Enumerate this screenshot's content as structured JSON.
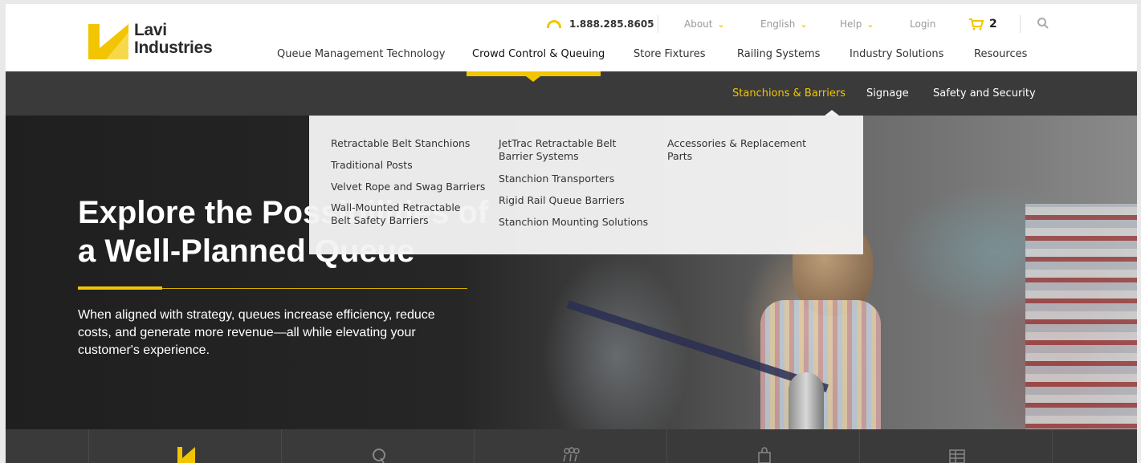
{
  "brand": {
    "name_line1": "Lavi",
    "name_line2": "Industries",
    "accent": "#f2c500"
  },
  "utility": {
    "phone": "1.888.285.8605",
    "about": "About",
    "language": "English",
    "help": "Help",
    "login": "Login",
    "cart_count": "2"
  },
  "main_nav": [
    "Queue Management Technology",
    "Crowd Control & Queuing",
    "Store Fixtures",
    "Railing Systems",
    "Industry Solutions",
    "Resources"
  ],
  "sub_nav": [
    "Stanchions & Barriers",
    "Signage",
    "Safety and Security"
  ],
  "dropdown": {
    "col1": [
      "Retractable Belt Stanchions",
      "Traditional Posts",
      "Velvet Rope and Swag Barriers",
      "Wall-Mounted Retractable Belt Safety Barriers"
    ],
    "col2": [
      "JetTrac Retractable Belt Barrier Systems",
      "Stanchion Transporters",
      "Rigid Rail Queue Barriers",
      "Stanchion Mounting Solutions"
    ],
    "col3": [
      "Accessories & Replacement Parts"
    ]
  },
  "hero": {
    "title": "Explore the Possibilities of a Well-Planned Queue",
    "body": "When aligned with strategy, queues increase efficiency, reduce costs, and generate more revenue—all while elevating your customer's experience."
  },
  "bottom_icons": [
    "lavi-logo-icon",
    "qless-icon",
    "people-icon",
    "bag-icon",
    "grid-icon"
  ]
}
